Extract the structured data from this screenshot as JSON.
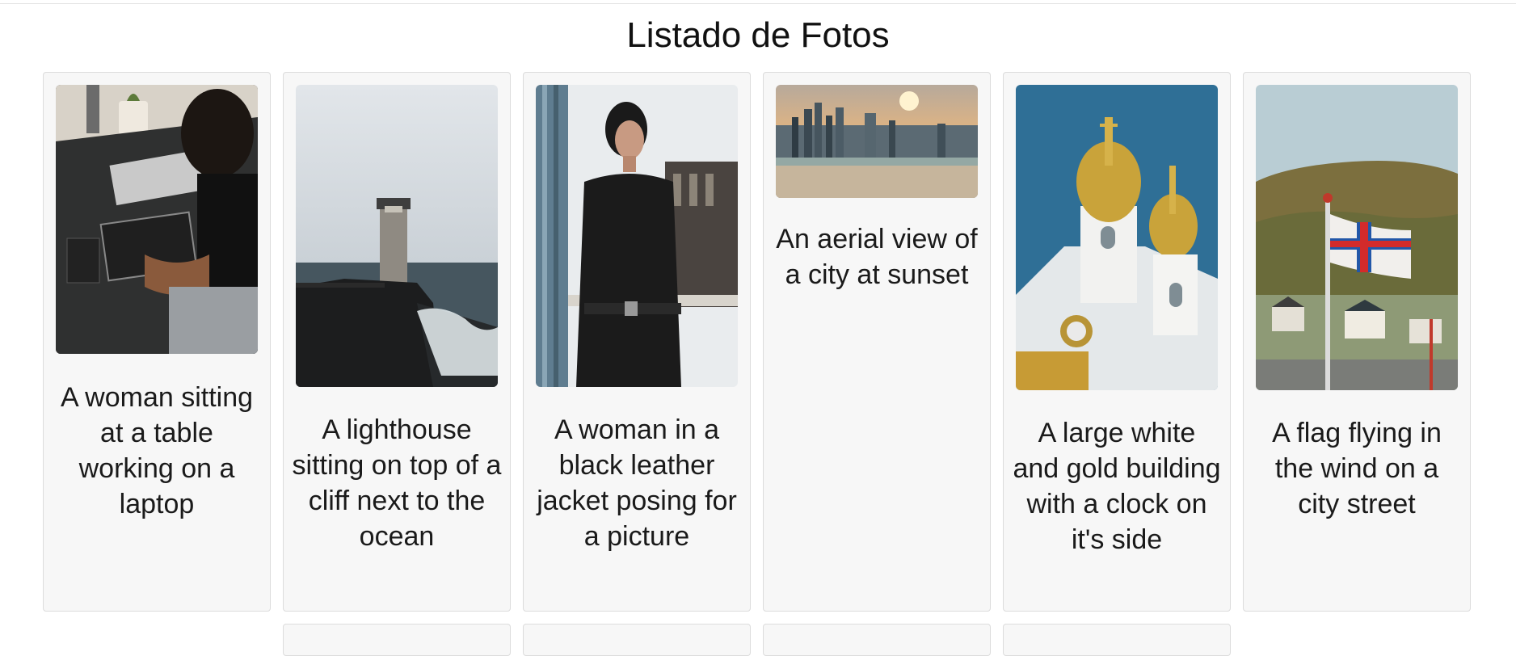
{
  "page": {
    "title": "Listado de Fotos"
  },
  "photos": [
    {
      "caption": "A woman sitting at a table working on a laptop",
      "image": "photo-woman-repairing-laptop"
    },
    {
      "caption": "A lighthouse sitting on top of a cliff next to the ocean",
      "image": "photo-lighthouse-cliff"
    },
    {
      "caption": "A woman in a black leather jacket posing for a picture",
      "image": "photo-woman-leather-jacket"
    },
    {
      "caption": "An aerial view of a city at sunset",
      "image": "photo-city-sunset-aerial"
    },
    {
      "caption": "A large white and gold building with a clock on it's side",
      "image": "photo-white-gold-palace"
    },
    {
      "caption": "A flag flying in the wind on a city street",
      "image": "photo-flag-hillside-town"
    }
  ]
}
